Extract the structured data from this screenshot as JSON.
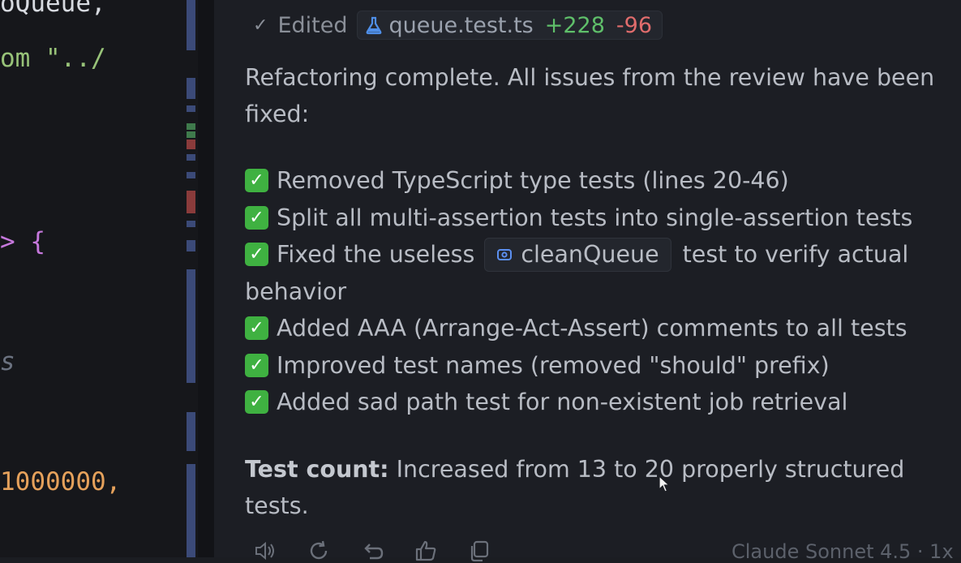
{
  "editor": {
    "lines": [
      {
        "text": "oQueue,",
        "cls": "c-plain"
      },
      {
        "text": "om \"../",
        "cls": "c-str"
      },
      {
        "text": "> {",
        "cls": "c-op"
      },
      {
        "text": "s",
        "cls": "c-comment"
      },
      {
        "text": "1000000,",
        "cls": "c-num"
      }
    ]
  },
  "edit_status": {
    "label": "Edited",
    "file_name": "queue.test.ts",
    "added": "+228",
    "removed": "-96"
  },
  "message": {
    "intro_line1": "Refactoring complete. All issues from the review have been",
    "intro_line2": "fixed:",
    "items": [
      "Removed TypeScript type tests (lines 20-46)",
      "Split all multi-assertion tests into single-assertion tests",
      "Added AAA (Arrange-Act-Assert) comments to all tests",
      "Improved test names (removed \"should\" prefix)",
      "Added sad path test for non-existent job retrieval"
    ],
    "item_fixed_prefix": "Fixed the useless",
    "item_fixed_code": "cleanQueue",
    "item_fixed_suffix": "test to verify actual",
    "item_fixed_cont": "behavior",
    "summary_label": "Test count:",
    "summary_text": "Increased from 13 to 20 properly structured",
    "summary_cont": "tests.",
    "check_glyph": "✓"
  },
  "footer": {
    "model": "Claude Sonnet 4.5 · 1x",
    "icons": [
      "speaker-icon",
      "retry-icon",
      "undo-icon",
      "thumbs-up-icon",
      "copy-icon"
    ]
  },
  "colors": {
    "added": "#5fbf6a",
    "removed": "#e06c6c",
    "check_bg": "#3fb141",
    "chat_bg": "#1c1e24"
  }
}
